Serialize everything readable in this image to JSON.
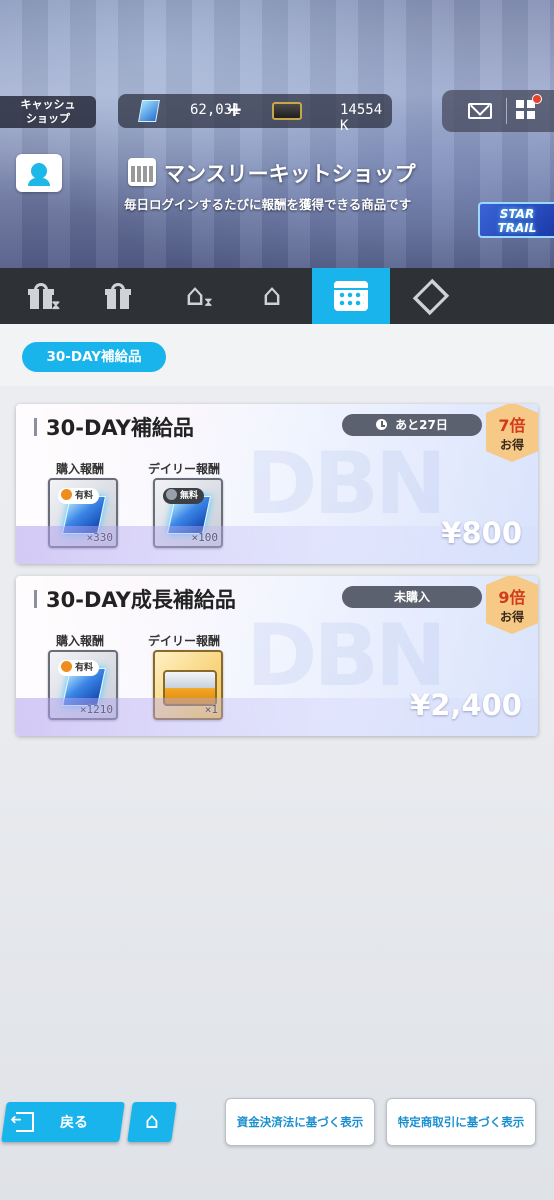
{
  "header": {
    "cash_shop_line1": "キャッシュ",
    "cash_shop_line2": "ショップ",
    "gem_count": "62,031",
    "plus": "+",
    "ticket_count": "14554 K",
    "title": "マンスリーキットショップ",
    "subtitle": "毎日ログインするたびに報酬を獲得できる商品です",
    "badge_line1": "STAR",
    "badge_line2": "TRAIL"
  },
  "tabs": [
    {
      "icon": "gift-hourglass-icon",
      "active": false
    },
    {
      "icon": "gift-icon",
      "active": false
    },
    {
      "icon": "hanger-hourglass-icon",
      "active": false
    },
    {
      "icon": "hanger-icon",
      "active": false
    },
    {
      "icon": "calendar-icon",
      "active": true
    },
    {
      "icon": "diamond-emblem-icon",
      "active": false
    }
  ],
  "subtab": {
    "label": "30-DAY補給品"
  },
  "cards": [
    {
      "title": "30-DAY補給品",
      "status": "あと27日",
      "multiplier": "7倍",
      "deal": "お得",
      "purchase_label": "購入報酬",
      "daily_label": "デイリー報酬",
      "purchase_tag": "有料",
      "purchase_qty": "×330",
      "daily_tag": "無料",
      "daily_qty": "×100",
      "price": "¥800"
    },
    {
      "title": "30-DAY成長補給品",
      "status": "未購入",
      "multiplier": "9倍",
      "deal": "お得",
      "purchase_label": "購入報酬",
      "daily_label": "デイリー報酬",
      "purchase_tag": "有料",
      "purchase_qty": "×1210",
      "daily_qty": "×1",
      "price": "¥2,400"
    }
  ],
  "footer": {
    "back_label": "戻る",
    "legal1": "資金決済法に基づく表示",
    "legal2": "特定商取引に基づく表示"
  },
  "colors": {
    "accent": "#1ab4ec",
    "tabbar": "#2e3236",
    "price_red": "#d23a19"
  }
}
